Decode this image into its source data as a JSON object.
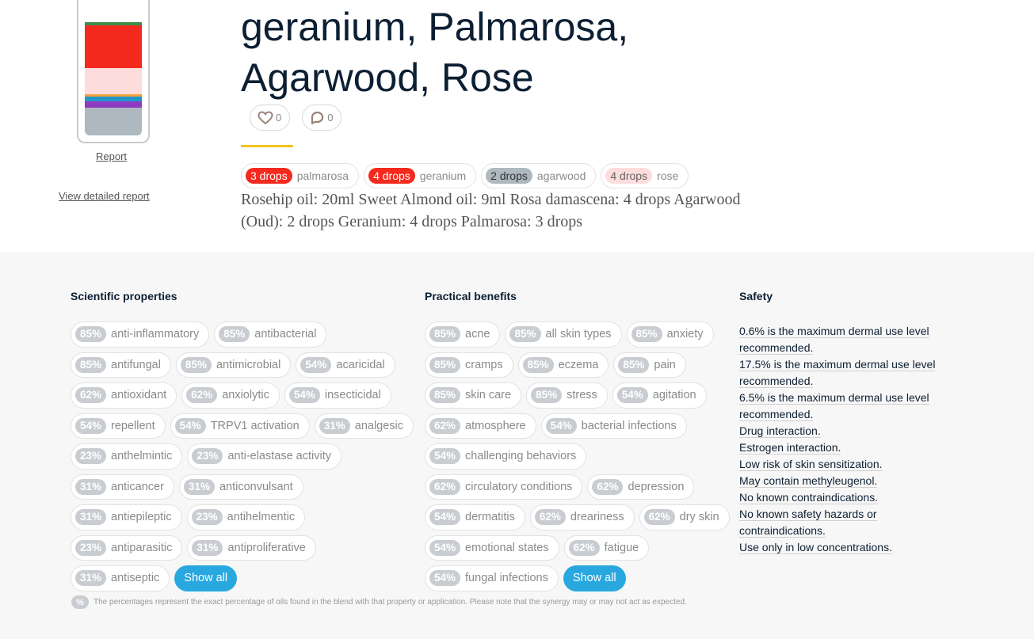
{
  "blend": {
    "title": "geranium, Palmarosa, Agarwood, Rose",
    "bottle_layers": [
      {
        "name": "green-cap",
        "color": "#3e8e48"
      },
      {
        "name": "geranium-red",
        "color": "#f52a1f"
      },
      {
        "name": "rose-pink",
        "color": "#fddcdc"
      },
      {
        "name": "stripe-orange",
        "color": "#f0a23c"
      },
      {
        "name": "stripe-blue",
        "color": "#2196c9"
      },
      {
        "name": "stripe-purple",
        "color": "#8e3bc2"
      },
      {
        "name": "agarwood-grey",
        "color": "#aeb8bf"
      }
    ],
    "report_label": "Report",
    "detailed_report_label": "View detailed report",
    "likes": "0",
    "comments": "0",
    "drops": [
      {
        "count": "3 drops",
        "oil": "palmarosa",
        "bg": "#f52a1f",
        "fg": "#ffffff"
      },
      {
        "count": "4 drops",
        "oil": "geranium",
        "bg": "#f52a1f",
        "fg": "#ffffff"
      },
      {
        "count": "2 drops",
        "oil": "agarwood",
        "bg": "#aeb8bf",
        "fg": "#333333"
      },
      {
        "count": "4 drops",
        "oil": "rose",
        "bg": "#fddcdc",
        "fg": "#666666"
      }
    ],
    "recipe": "Rosehip oil: 20ml Sweet Almond oil: 9ml Rosa damascena: 4 drops Agarwood (Oud): 2 drops Geranium: 4 drops Palmarosa: 3 drops"
  },
  "scientific": {
    "heading": "Scientific properties",
    "items": [
      {
        "pct": "85%",
        "label": "anti-inflammatory"
      },
      {
        "pct": "85%",
        "label": "antibacterial"
      },
      {
        "pct": "85%",
        "label": "antifungal"
      },
      {
        "pct": "85%",
        "label": "antimicrobial"
      },
      {
        "pct": "54%",
        "label": "acaricidal"
      },
      {
        "pct": "62%",
        "label": "antioxidant"
      },
      {
        "pct": "62%",
        "label": "anxiolytic"
      },
      {
        "pct": "54%",
        "label": "insecticidal"
      },
      {
        "pct": "54%",
        "label": "repellent"
      },
      {
        "pct": "54%",
        "label": "TRPV1 activation"
      },
      {
        "pct": "31%",
        "label": "analgesic"
      },
      {
        "pct": "23%",
        "label": "anthelmintic"
      },
      {
        "pct": "23%",
        "label": "anti-elastase activity"
      },
      {
        "pct": "31%",
        "label": "anticancer"
      },
      {
        "pct": "31%",
        "label": "anticonvulsant"
      },
      {
        "pct": "31%",
        "label": "antiepileptic"
      },
      {
        "pct": "23%",
        "label": "antihelmentic"
      },
      {
        "pct": "23%",
        "label": "antiparasitic"
      },
      {
        "pct": "31%",
        "label": "antiproliferative"
      },
      {
        "pct": "31%",
        "label": "antiseptic"
      }
    ],
    "show_all": "Show all"
  },
  "practical": {
    "heading": "Practical benefits",
    "items": [
      {
        "pct": "85%",
        "label": "acne"
      },
      {
        "pct": "85%",
        "label": "all skin types"
      },
      {
        "pct": "85%",
        "label": "anxiety"
      },
      {
        "pct": "85%",
        "label": "cramps"
      },
      {
        "pct": "85%",
        "label": "eczema"
      },
      {
        "pct": "85%",
        "label": "pain"
      },
      {
        "pct": "85%",
        "label": "skin care"
      },
      {
        "pct": "85%",
        "label": "stress"
      },
      {
        "pct": "54%",
        "label": "agitation"
      },
      {
        "pct": "62%",
        "label": "atmosphere"
      },
      {
        "pct": "54%",
        "label": "bacterial infections"
      },
      {
        "pct": "54%",
        "label": "challenging behaviors"
      },
      {
        "pct": "62%",
        "label": "circulatory conditions"
      },
      {
        "pct": "62%",
        "label": "depression"
      },
      {
        "pct": "54%",
        "label": "dermatitis"
      },
      {
        "pct": "62%",
        "label": "dreariness"
      },
      {
        "pct": "62%",
        "label": "dry skin"
      },
      {
        "pct": "54%",
        "label": "emotional states"
      },
      {
        "pct": "62%",
        "label": "fatigue"
      },
      {
        "pct": "54%",
        "label": "fungal infections"
      }
    ],
    "show_all": "Show all"
  },
  "safety": {
    "heading": "Safety",
    "items": [
      "0.6% is the maximum dermal use level recommended.",
      "17.5% is the maximum dermal use level recommended.",
      "6.5% is the maximum dermal use level recommended.",
      "Drug interaction.",
      "Estrogen interaction.",
      "Low risk of skin sensitization.",
      "May contain methyleugenol.",
      "No known contraindications.",
      "No known safety hazards or contraindications.",
      "Use only in low concentrations."
    ]
  },
  "footnote": {
    "badge": "%",
    "text": "The percentages represent the exact percentage of oils found in the blend with that property or application. Please note that the synergy may or may not act as expected."
  }
}
